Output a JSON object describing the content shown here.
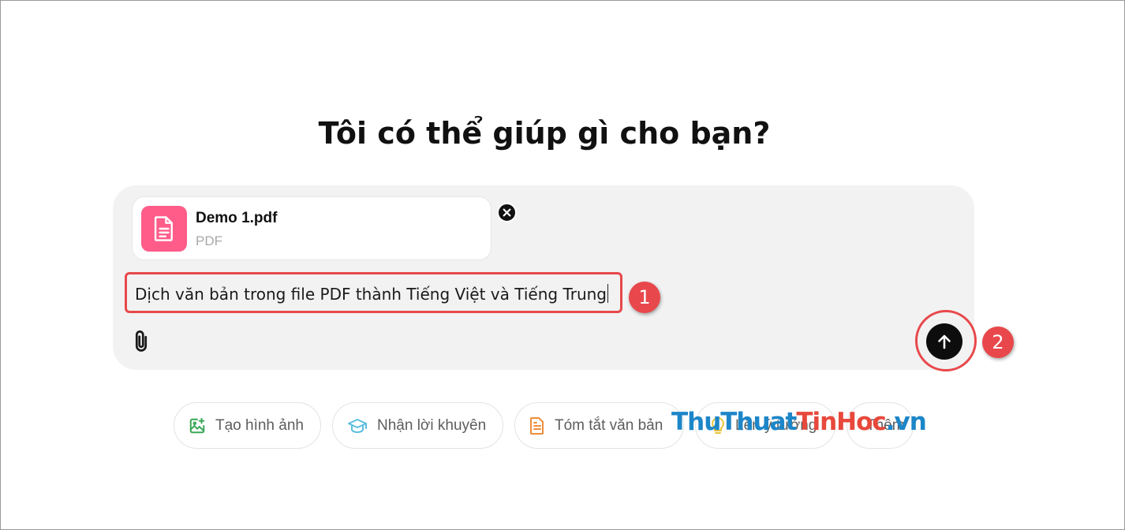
{
  "heading": "Tôi có thể giúp gì cho bạn?",
  "attachment": {
    "file_name": "Demo 1.pdf",
    "file_type": "PDF",
    "thumb_color": "#ff5c8a"
  },
  "prompt": {
    "value": "Dịch văn bản trong file PDF thành Tiếng Việt và Tiếng Trung"
  },
  "annotations": {
    "step_1": "1",
    "step_2": "2",
    "highlight_color": "#e8484b"
  },
  "icons": {
    "attach": "paperclip-icon",
    "send": "arrow-up-icon",
    "remove_file": "close-icon",
    "file": "document-icon"
  },
  "suggestions": [
    {
      "label": "Tạo hình ảnh",
      "icon": "image-create-icon",
      "color": "#3aa757"
    },
    {
      "label": "Nhận lời khuyên",
      "icon": "graduation-cap-icon",
      "color": "#5bbde0"
    },
    {
      "label": "Tóm tắt văn bản",
      "icon": "document-icon",
      "color": "#ef8d3a"
    },
    {
      "label": "Lên ý tưởng",
      "icon": "lightbulb-icon",
      "color": "#e7c43c"
    },
    {
      "label": "Thêm",
      "icon": "",
      "color": ""
    }
  ],
  "watermark": {
    "part_a": "ThuThuat",
    "part_b": "TinHoc",
    "part_c": ".vn"
  }
}
